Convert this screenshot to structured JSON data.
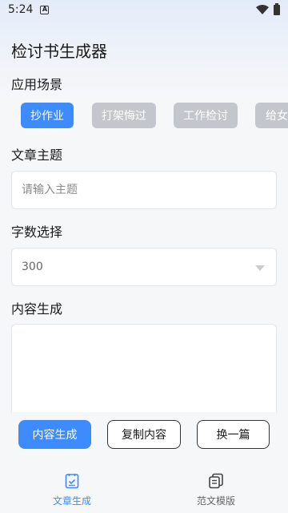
{
  "status_bar": {
    "time": "5:24",
    "notification_letter": "A"
  },
  "page": {
    "title": "检讨书生成器"
  },
  "scene": {
    "label": "应用场景",
    "chips": [
      {
        "label": "抄作业",
        "active": true
      },
      {
        "label": "打架悔过",
        "active": false
      },
      {
        "label": "工作检讨",
        "active": false
      },
      {
        "label": "给女友",
        "active": false
      }
    ]
  },
  "topic": {
    "label": "文章主题",
    "placeholder": "请输入主题",
    "value": ""
  },
  "word_count": {
    "label": "字数选择",
    "selected": "300"
  },
  "content": {
    "label": "内容生成",
    "value": ""
  },
  "actions": {
    "generate": "内容生成",
    "copy": "复制内容",
    "another": "换一篇"
  },
  "tabs": [
    {
      "label": "文章生成",
      "icon": "document-check-icon",
      "active": true
    },
    {
      "label": "范文模版",
      "icon": "copy-document-icon",
      "active": false
    }
  ],
  "colors": {
    "accent": "#3d8bfd",
    "chip_inactive": "#c3c6cc"
  }
}
